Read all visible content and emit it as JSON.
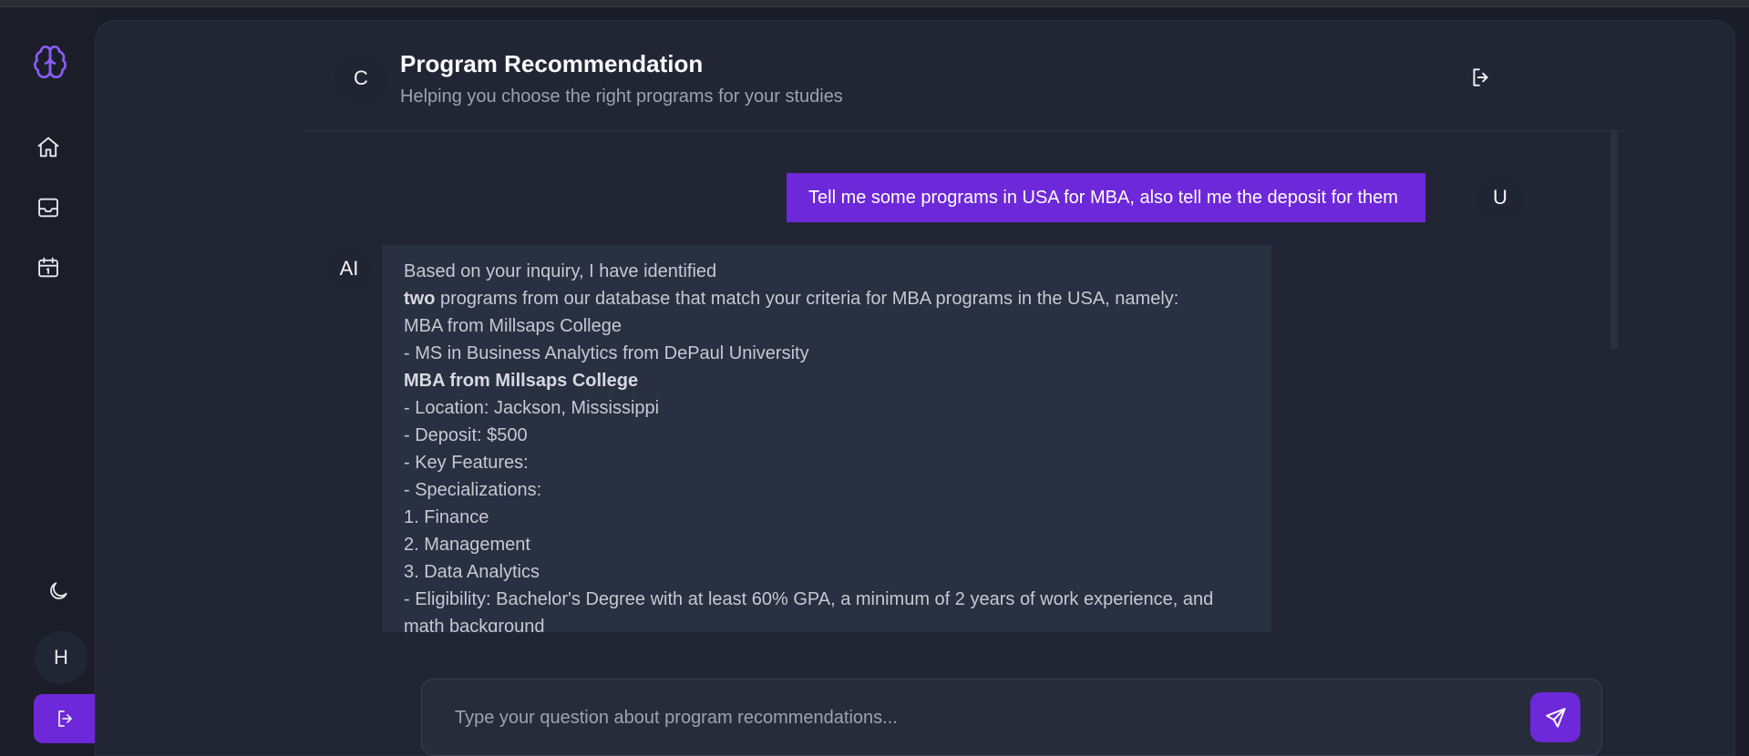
{
  "header": {
    "avatar_letter": "C",
    "title": "Program Recommendation",
    "subtitle": "Helping you choose the right programs for your studies"
  },
  "sidebar": {
    "avatar_letter": "H",
    "icons": [
      "brain-logo-icon",
      "home-icon",
      "inbox-icon",
      "calendar-icon",
      "moon-icon",
      "logout-icon"
    ]
  },
  "chat": {
    "user_avatar": "U",
    "user_message": "Tell me some programs in USA for MBA, also tell me the deposit for them",
    "ai_avatar": "AI",
    "ai_message": {
      "line1": "Based on your inquiry, I have identified",
      "line2_bold": "two",
      "line2_rest": " programs from our database that match your criteria for MBA programs in the USA, namely:",
      "line3": "MBA from Millsaps College",
      "line4": "- MS in Business Analytics from DePaul University",
      "line5": "MBA from Millsaps College",
      "line6": "- Location: Jackson, Mississippi",
      "line7": "- Deposit: $500",
      "line8": "- Key Features:",
      "line9": "- Specializations:",
      "line10": "1. Finance",
      "line11": "2. Management",
      "line12": "3. Data Analytics",
      "line13": "- Eligibility: Bachelor's Degree with at least 60% GPA, a minimum of 2 years of work experience, and math background"
    }
  },
  "input": {
    "placeholder": "Type your question about program recommendations..."
  },
  "colors": {
    "accent": "#6d28d9",
    "logo": "#8b5cf6",
    "background": "#222634",
    "sidebar": "#1b1e29"
  }
}
